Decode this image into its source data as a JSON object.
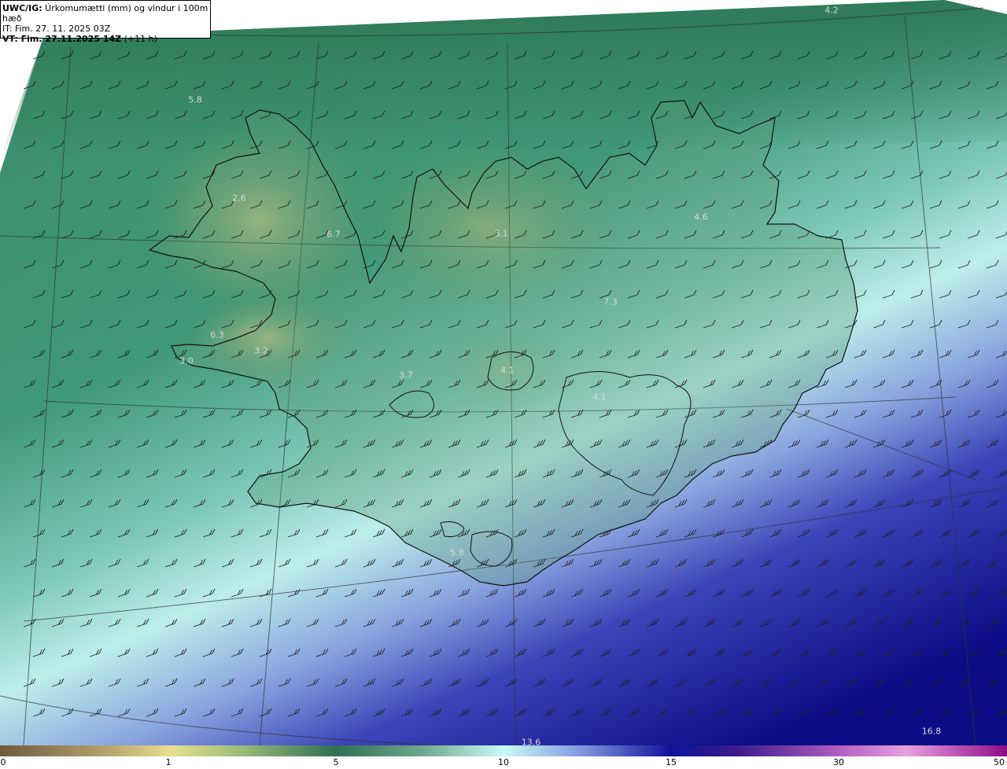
{
  "header": {
    "line1_prefix": "UWC/IG:",
    "line1_text": " Úrkomumætti (mm) og vindur i 100m hæð",
    "line2": "IT: Fim. 27. 11. 2025 03Z",
    "line3_prefix": "VT: Fim. 27.11.2025 14Z",
    "line3_text": " (+11 h)"
  },
  "map_labels": [
    {
      "text": "4.2"
    },
    {
      "text": "5.8"
    },
    {
      "text": "2.6"
    },
    {
      "text": "6.7"
    },
    {
      "text": "3.1"
    },
    {
      "text": "4.6"
    },
    {
      "text": "7.3"
    },
    {
      "text": "6.3"
    },
    {
      "text": "3.2"
    },
    {
      "text": "3.0"
    },
    {
      "text": "3.7"
    },
    {
      "text": "4.1"
    },
    {
      "text": "4.1"
    },
    {
      "text": "5.8"
    },
    {
      "text": "13.6"
    },
    {
      "text": "16.8"
    }
  ],
  "colorbar": {
    "ticks": [
      "0",
      "1",
      "5",
      "10",
      "15",
      "30",
      "50"
    ],
    "colors": [
      "#6e5a3c",
      "#c9b77a",
      "#e6df8f",
      "#3e8a5a",
      "#2f6f55",
      "#6fa88f",
      "#bff2ee",
      "#8fa3e6",
      "#2a2fb0",
      "#0a0a7a",
      "#6a2a9a",
      "#d06ad0",
      "#9b0f8f"
    ]
  }
}
